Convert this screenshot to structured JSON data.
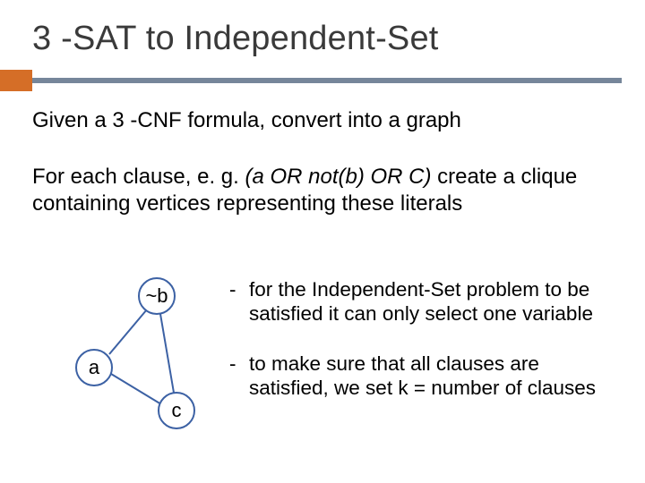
{
  "title": "3 -SAT to Independent-Set",
  "para1": "Given a 3 -CNF formula, convert into a graph",
  "para2_pre": "For each clause, e. g. ",
  "para2_italic": "(a OR not(b) OR C)",
  "para2_post": " create a clique containing vertices representing these literals",
  "nodes": {
    "b": "~b",
    "a": "a",
    "c": "c"
  },
  "notes": {
    "n1": "for the Independent-Set problem to be satisfied it can only select one variable",
    "n2": "to make sure that all clauses are satisfied, we set k = number of clauses"
  },
  "dash": "-"
}
